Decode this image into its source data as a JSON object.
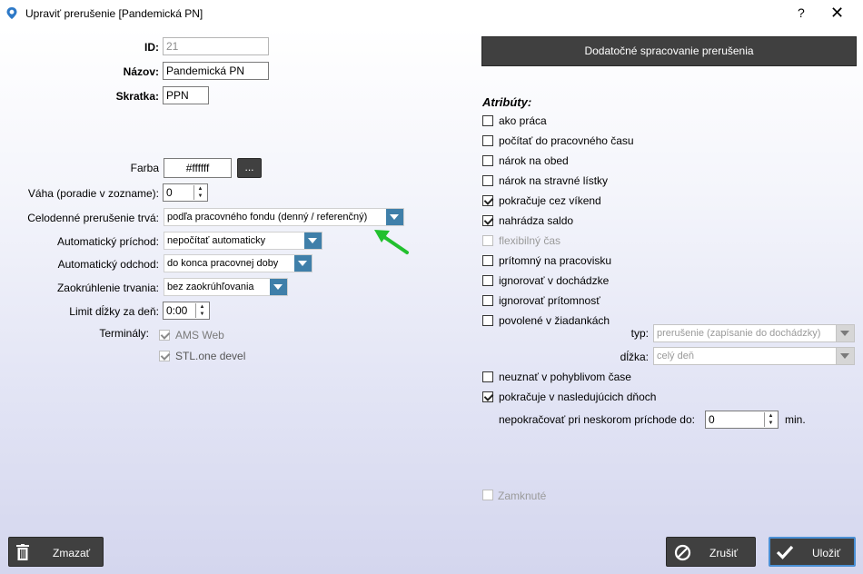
{
  "window": {
    "title": "Upraviť prerušenie [Pandemická PN]",
    "help_label": "?",
    "close_label": "✕"
  },
  "form": {
    "id_label": "ID:",
    "id_value": "21",
    "name_label": "Názov:",
    "name_value": "Pandemická PN",
    "abbr_label": "Skratka:",
    "abbr_value": "PPN",
    "color_label": "Farba",
    "color_value": "#ffffff",
    "color_button": "...",
    "weight_label": "Váha (poradie v zozname):",
    "weight_value": "0",
    "fullday_label": "Celodenné prerušenie trvá:",
    "fullday_value": "podľa pracovného fondu (denný / referenčný)",
    "arrival_label": "Automatický príchod:",
    "arrival_value": "nepočítať automaticky",
    "departure_label": "Automatický odchod:",
    "departure_value": "do konca pracovnej doby",
    "rounding_label": "Zaokrúhlenie trvania:",
    "rounding_value": "bez zaokrúhľovania",
    "daylimit_label": "Limit dĺžky za deň:",
    "daylimit_value": "0:00",
    "terminals_label": "Terminály:",
    "terminals": [
      {
        "label": "AMS Web",
        "checked": true
      },
      {
        "label": "STL.one devel",
        "checked": true
      }
    ]
  },
  "right": {
    "extra_button": "Dodatočné spracovanie prerušenia",
    "attributes_title": "Atribúty:",
    "attributes": [
      {
        "label": "ako práca",
        "checked": false,
        "disabled": false
      },
      {
        "label": "počítať do pracovného času",
        "checked": false,
        "disabled": false
      },
      {
        "label": "nárok na obed",
        "checked": false,
        "disabled": false
      },
      {
        "label": "nárok na stravné lístky",
        "checked": false,
        "disabled": false
      },
      {
        "label": "pokračuje cez víkend",
        "checked": true,
        "disabled": false
      },
      {
        "label": "nahrádza saldo",
        "checked": true,
        "disabled": false
      },
      {
        "label": "flexibilný čas",
        "checked": false,
        "disabled": true
      },
      {
        "label": "prítomný na pracovisku",
        "checked": false,
        "disabled": false
      },
      {
        "label": "ignorovať v dochádzke",
        "checked": false,
        "disabled": false
      },
      {
        "label": "ignorovať prítomnosť",
        "checked": false,
        "disabled": false
      },
      {
        "label": "povolené v žiadankách",
        "checked": false,
        "disabled": false
      }
    ],
    "type_label": "typ:",
    "type_value": "prerušenie (zapísanie do dochádzky)",
    "length_label": "dĺžka:",
    "length_value": "celý deň",
    "attributes2": [
      {
        "label": "neuznať v pohyblivom čase",
        "checked": false
      },
      {
        "label": "pokračuje v nasledujúcich dňoch",
        "checked": true
      }
    ],
    "late_label": "nepokračovať pri neskorom príchode do:",
    "late_value": "0",
    "late_unit": "min.",
    "locked_label": "Zamknuté",
    "locked_checked": false
  },
  "footer": {
    "delete_label": "Zmazať",
    "cancel_label": "Zrušiť",
    "save_label": "Uložiť"
  },
  "colors": {
    "combo_arrow": "#3f7fa9",
    "annotation_arrow": "#22c02e",
    "save_border": "#4a8fd4"
  }
}
